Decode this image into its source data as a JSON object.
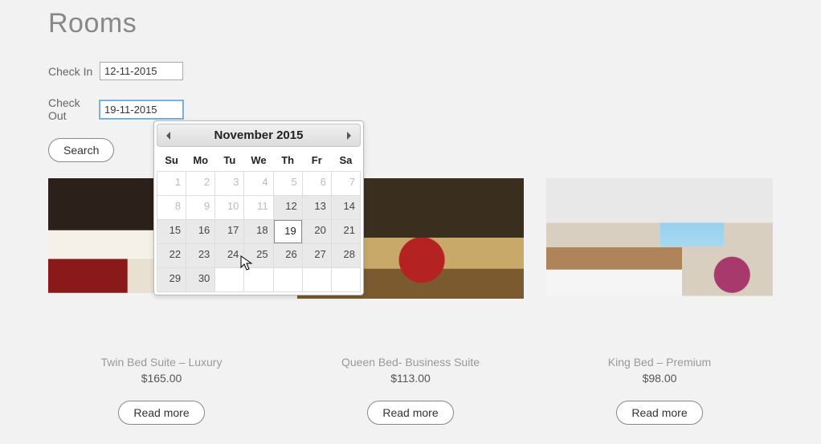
{
  "page": {
    "title": "Rooms"
  },
  "form": {
    "checkin_label": "Check In",
    "checkin_value": "12-11-2015",
    "checkout_label": "Check Out",
    "checkout_value": "19-11-2015",
    "search_label": "Search"
  },
  "datepicker": {
    "month_title": "November 2015",
    "dow": [
      "Su",
      "Mo",
      "Tu",
      "We",
      "Th",
      "Fr",
      "Sa"
    ],
    "weeks": [
      [
        {
          "d": 1,
          "s": "disabled"
        },
        {
          "d": 2,
          "s": "disabled"
        },
        {
          "d": 3,
          "s": "disabled"
        },
        {
          "d": 4,
          "s": "disabled"
        },
        {
          "d": 5,
          "s": "disabled"
        },
        {
          "d": 6,
          "s": "disabled"
        },
        {
          "d": 7,
          "s": "disabled"
        }
      ],
      [
        {
          "d": 8,
          "s": "disabled"
        },
        {
          "d": 9,
          "s": "disabled"
        },
        {
          "d": 10,
          "s": "disabled"
        },
        {
          "d": 11,
          "s": "disabled"
        },
        {
          "d": 12,
          "s": "enabled"
        },
        {
          "d": 13,
          "s": "enabled"
        },
        {
          "d": 14,
          "s": "enabled"
        }
      ],
      [
        {
          "d": 15,
          "s": "enabled"
        },
        {
          "d": 16,
          "s": "enabled"
        },
        {
          "d": 17,
          "s": "enabled"
        },
        {
          "d": 18,
          "s": "enabled"
        },
        {
          "d": 19,
          "s": "selected"
        },
        {
          "d": 20,
          "s": "enabled"
        },
        {
          "d": 21,
          "s": "enabled"
        }
      ],
      [
        {
          "d": 22,
          "s": "enabled"
        },
        {
          "d": 23,
          "s": "enabled"
        },
        {
          "d": 24,
          "s": "enabled"
        },
        {
          "d": 25,
          "s": "enabled"
        },
        {
          "d": 26,
          "s": "enabled"
        },
        {
          "d": 27,
          "s": "enabled"
        },
        {
          "d": 28,
          "s": "enabled"
        }
      ],
      [
        {
          "d": 29,
          "s": "enabled"
        },
        {
          "d": 30,
          "s": "enabled"
        },
        {
          "d": "",
          "s": "empty"
        },
        {
          "d": "",
          "s": "empty"
        },
        {
          "d": "",
          "s": "empty"
        },
        {
          "d": "",
          "s": "empty"
        },
        {
          "d": "",
          "s": "empty"
        }
      ]
    ]
  },
  "rooms": [
    {
      "title": "Twin Bed Suite – Luxury",
      "price": "$165.00",
      "cta": "Read more",
      "img": "img1"
    },
    {
      "title": "Queen Bed- Business Suite",
      "price": "$113.00",
      "cta": "Read more",
      "img": "img2"
    },
    {
      "title": "King Bed – Premium",
      "price": "$98.00",
      "cta": "Read more",
      "img": "img3"
    }
  ]
}
